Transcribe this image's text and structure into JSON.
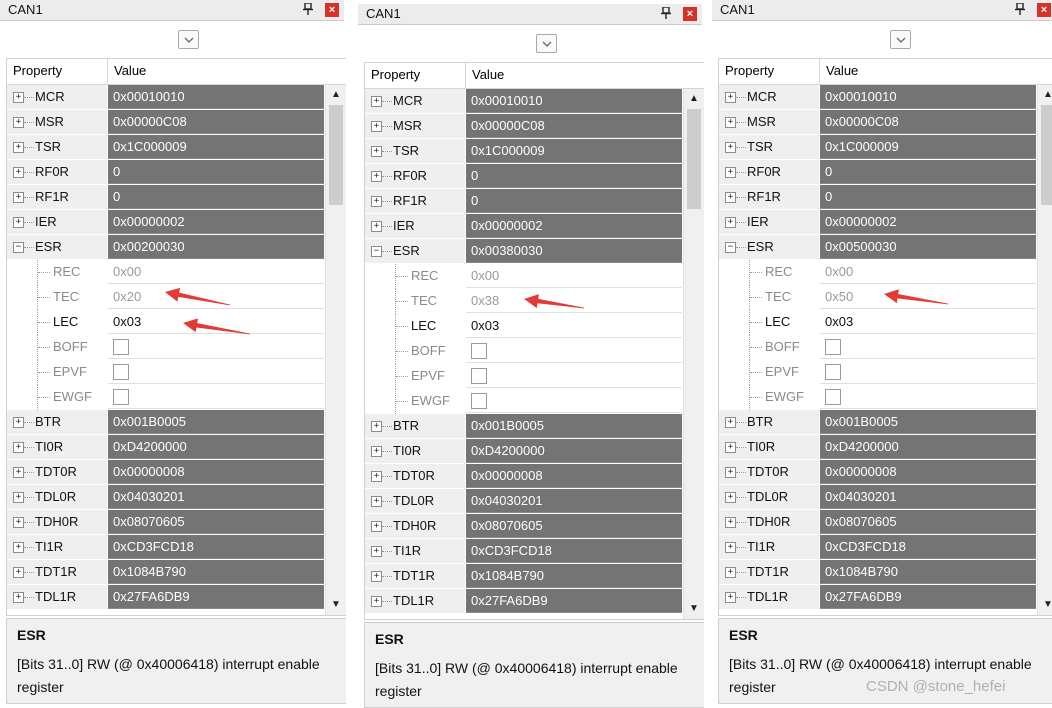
{
  "colors": {
    "accent_red": "#e53935",
    "register_value_bg": "#747474",
    "close_button": "#d9302a"
  },
  "panels": [
    {
      "title": "CAN1",
      "pin_icon": "pin-icon",
      "close_icon": "close-icon",
      "dropdown_icon": "chevron-down-icon",
      "columns": {
        "property": "Property",
        "value": "Value"
      },
      "registers_before": [
        {
          "name": "MCR",
          "value": "0x00010010",
          "expander": "+"
        },
        {
          "name": "MSR",
          "value": "0x00000C08",
          "expander": "+"
        },
        {
          "name": "TSR",
          "value": "0x1C000009",
          "expander": "+"
        },
        {
          "name": "RF0R",
          "value": "0",
          "expander": "+"
        },
        {
          "name": "RF1R",
          "value": "0",
          "expander": "+"
        },
        {
          "name": "IER",
          "value": "0x00000002",
          "expander": "+"
        },
        {
          "name": "ESR",
          "value": "0x00200030",
          "expander": "−"
        }
      ],
      "esr_fields": [
        {
          "name": "REC",
          "value": "0x00"
        },
        {
          "name": "TEC",
          "value": "0x20"
        },
        {
          "name": "LEC",
          "value": "0x03"
        },
        {
          "name": "BOFF",
          "value": ""
        },
        {
          "name": "EPVF",
          "value": ""
        },
        {
          "name": "EWGF",
          "value": ""
        }
      ],
      "registers_after": [
        {
          "name": "BTR",
          "value": "0x001B0005",
          "expander": "+"
        },
        {
          "name": "TI0R",
          "value": "0xD4200000",
          "expander": "+"
        },
        {
          "name": "TDT0R",
          "value": "0x00000008",
          "expander": "+"
        },
        {
          "name": "TDL0R",
          "value": "0x04030201",
          "expander": "+"
        },
        {
          "name": "TDH0R",
          "value": "0x08070605",
          "expander": "+"
        },
        {
          "name": "TI1R",
          "value": "0xCD3FCD18",
          "expander": "+"
        },
        {
          "name": "TDT1R",
          "value": "0x1084B790",
          "expander": "+"
        },
        {
          "name": "TDL1R",
          "value": "0x27FA6DB9",
          "expander": "+"
        }
      ],
      "description": {
        "title": "ESR",
        "text": "[Bits 31..0] RW (@ 0x40006418) interrupt enable register"
      }
    },
    {
      "title": "CAN1",
      "pin_icon": "pin-icon",
      "close_icon": "close-icon",
      "dropdown_icon": "chevron-down-icon",
      "columns": {
        "property": "Property",
        "value": "Value"
      },
      "registers_before": [
        {
          "name": "MCR",
          "value": "0x00010010",
          "expander": "+"
        },
        {
          "name": "MSR",
          "value": "0x00000C08",
          "expander": "+"
        },
        {
          "name": "TSR",
          "value": "0x1C000009",
          "expander": "+"
        },
        {
          "name": "RF0R",
          "value": "0",
          "expander": "+"
        },
        {
          "name": "RF1R",
          "value": "0",
          "expander": "+"
        },
        {
          "name": "IER",
          "value": "0x00000002",
          "expander": "+"
        },
        {
          "name": "ESR",
          "value": "0x00380030",
          "expander": "−"
        }
      ],
      "esr_fields": [
        {
          "name": "REC",
          "value": "0x00"
        },
        {
          "name": "TEC",
          "value": "0x38"
        },
        {
          "name": "LEC",
          "value": "0x03"
        },
        {
          "name": "BOFF",
          "value": ""
        },
        {
          "name": "EPVF",
          "value": ""
        },
        {
          "name": "EWGF",
          "value": ""
        }
      ],
      "registers_after": [
        {
          "name": "BTR",
          "value": "0x001B0005",
          "expander": "+"
        },
        {
          "name": "TI0R",
          "value": "0xD4200000",
          "expander": "+"
        },
        {
          "name": "TDT0R",
          "value": "0x00000008",
          "expander": "+"
        },
        {
          "name": "TDL0R",
          "value": "0x04030201",
          "expander": "+"
        },
        {
          "name": "TDH0R",
          "value": "0x08070605",
          "expander": "+"
        },
        {
          "name": "TI1R",
          "value": "0xCD3FCD18",
          "expander": "+"
        },
        {
          "name": "TDT1R",
          "value": "0x1084B790",
          "expander": "+"
        },
        {
          "name": "TDL1R",
          "value": "0x27FA6DB9",
          "expander": "+"
        }
      ],
      "description": {
        "title": "ESR",
        "text": "[Bits 31..0] RW (@ 0x40006418) interrupt enable register"
      }
    },
    {
      "title": "CAN1",
      "pin_icon": "pin-icon",
      "close_icon": "close-icon",
      "dropdown_icon": "chevron-down-icon",
      "columns": {
        "property": "Property",
        "value": "Value"
      },
      "registers_before": [
        {
          "name": "MCR",
          "value": "0x00010010",
          "expander": "+"
        },
        {
          "name": "MSR",
          "value": "0x00000C08",
          "expander": "+"
        },
        {
          "name": "TSR",
          "value": "0x1C000009",
          "expander": "+"
        },
        {
          "name": "RF0R",
          "value": "0",
          "expander": "+"
        },
        {
          "name": "RF1R",
          "value": "0",
          "expander": "+"
        },
        {
          "name": "IER",
          "value": "0x00000002",
          "expander": "+"
        },
        {
          "name": "ESR",
          "value": "0x00500030",
          "expander": "−"
        }
      ],
      "esr_fields": [
        {
          "name": "REC",
          "value": "0x00"
        },
        {
          "name": "TEC",
          "value": "0x50"
        },
        {
          "name": "LEC",
          "value": "0x03"
        },
        {
          "name": "BOFF",
          "value": ""
        },
        {
          "name": "EPVF",
          "value": ""
        },
        {
          "name": "EWGF",
          "value": ""
        }
      ],
      "registers_after": [
        {
          "name": "BTR",
          "value": "0x001B0005",
          "expander": "+"
        },
        {
          "name": "TI0R",
          "value": "0xD4200000",
          "expander": "+"
        },
        {
          "name": "TDT0R",
          "value": "0x00000008",
          "expander": "+"
        },
        {
          "name": "TDL0R",
          "value": "0x04030201",
          "expander": "+"
        },
        {
          "name": "TDH0R",
          "value": "0x08070605",
          "expander": "+"
        },
        {
          "name": "TI1R",
          "value": "0xCD3FCD18",
          "expander": "+"
        },
        {
          "name": "TDT1R",
          "value": "0x1084B790",
          "expander": "+"
        },
        {
          "name": "TDL1R",
          "value": "0x27FA6DB9",
          "expander": "+"
        }
      ],
      "description": {
        "title": "ESR",
        "text": "[Bits 31..0] RW (@ 0x40006418) interrupt enable register"
      }
    }
  ],
  "watermark": "CSDN @stone_hefei"
}
